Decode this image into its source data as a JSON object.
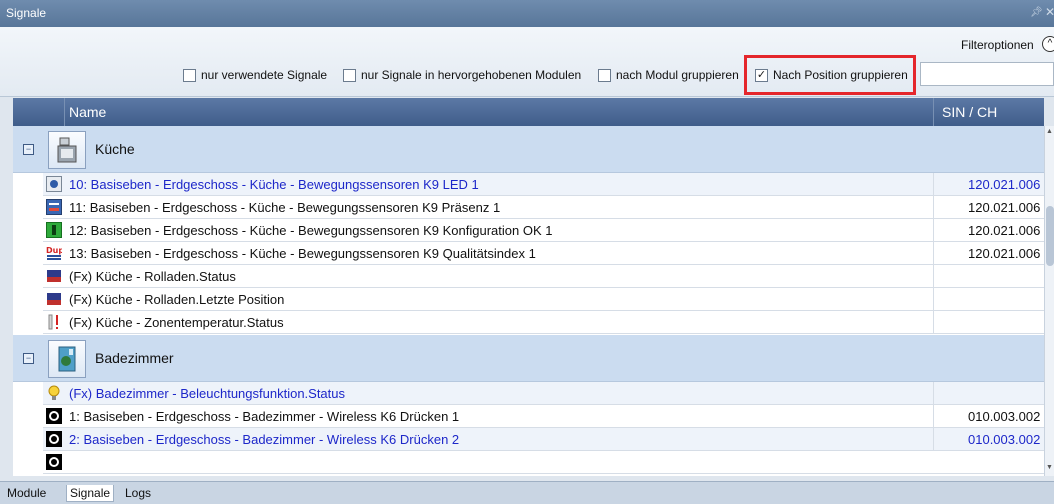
{
  "window": {
    "title": "Signale"
  },
  "filter": {
    "options_label": "Filteroptionen",
    "checkboxes": [
      {
        "label": "nur verwendete Signale",
        "checked": false
      },
      {
        "label": "nur Signale in hervorgehobenen Modulen",
        "checked": false
      },
      {
        "label": "nach Modul gruppieren",
        "checked": false
      },
      {
        "label": "Nach Position gruppieren",
        "checked": true
      }
    ],
    "search_value": ""
  },
  "columns": {
    "name": "Name",
    "sin": "SIN / CH"
  },
  "groups": [
    {
      "label": "Küche",
      "rows": [
        {
          "text": "10: Basiseben - Erdgeschoss - Küche - Bewegungssensoren K9 LED 1",
          "sin": "120.021.006",
          "highlight": true
        },
        {
          "text": "11: Basiseben - Erdgeschoss - Küche - Bewegungssensoren K9 Präsenz 1",
          "sin": "120.021.006"
        },
        {
          "text": "12: Basiseben - Erdgeschoss - Küche - Bewegungssensoren K9 Konfiguration OK 1",
          "sin": "120.021.006"
        },
        {
          "text": "13: Basiseben - Erdgeschoss - Küche - Bewegungssensoren K9 Qualitätsindex 1",
          "sin": "120.021.006"
        },
        {
          "text": "(Fx) Küche - Rolladen.Status",
          "sin": ""
        },
        {
          "text": "(Fx) Küche - Rolladen.Letzte Position",
          "sin": ""
        },
        {
          "text": "(Fx) Küche - Zonentemperatur.Status",
          "sin": ""
        }
      ]
    },
    {
      "label": "Badezimmer",
      "rows": [
        {
          "text": "(Fx) Badezimmer - Beleuchtungsfunktion.Status",
          "sin": "",
          "highlight": true
        },
        {
          "text": "1: Basiseben - Erdgeschoss - Badezimmer - Wireless K6 Drücken 1",
          "sin": "010.003.002"
        },
        {
          "text": "2: Basiseben - Erdgeschoss - Badezimmer - Wireless K6 Drücken 2",
          "sin": "010.003.002",
          "highlight": true
        }
      ]
    }
  ],
  "tabs": [
    {
      "label": "Module"
    },
    {
      "label": "Signale",
      "active": true
    },
    {
      "label": "Logs"
    }
  ]
}
